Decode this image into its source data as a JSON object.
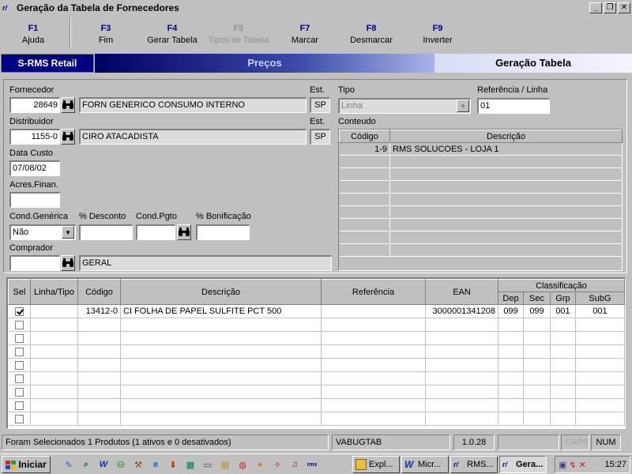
{
  "window": {
    "title": "Geração da Tabela de Fornecedores",
    "controls": {
      "minimize": "_",
      "maximize": "❐",
      "close": "✕"
    }
  },
  "fkeys": [
    {
      "key": "F1",
      "label": "Ajuda",
      "enabled": true
    },
    {
      "key": "F3",
      "label": "Fim",
      "enabled": true
    },
    {
      "key": "F4",
      "label": "Gerar Tabela",
      "enabled": true
    },
    {
      "key": "F5",
      "label": "Tipos de Tabela",
      "enabled": false
    },
    {
      "key": "F7",
      "label": "Marcar",
      "enabled": true
    },
    {
      "key": "F8",
      "label": "Desmarcar",
      "enabled": true
    },
    {
      "key": "F9",
      "label": "Inverter",
      "enabled": true
    }
  ],
  "banner": {
    "product": "S-RMS Retail",
    "module": "Preços",
    "screen": "Geração Tabela"
  },
  "form": {
    "fornecedor": {
      "label": "Fornecedor",
      "code": "28649",
      "name": "FORN GENERICO CONSUMO INTERNO",
      "est_label": "Est.",
      "est": "SP"
    },
    "distribuidor": {
      "label": "Distribuidor",
      "code": "1155-0",
      "name": "CIRO ATACADISTA",
      "est_label": "Est.",
      "est": "SP"
    },
    "data_custo": {
      "label": "Data Custo",
      "value": "07/08/02"
    },
    "acres_finan": {
      "label": "Acres.Finan.",
      "value": ""
    },
    "cond_generica": {
      "label": "Cond.Genérica",
      "value": "Não"
    },
    "desconto": {
      "label": "% Desconto",
      "value": ""
    },
    "cond_pgto": {
      "label": "Cond.Pgto",
      "value": ""
    },
    "bonificacao": {
      "label": "% Bonificação",
      "value": ""
    },
    "comprador": {
      "label": "Comprador",
      "code": "",
      "name": "GERAL"
    },
    "tipo": {
      "label": "Tipo",
      "value": "Linha"
    },
    "referencia_linha": {
      "label": "Referência / Linha",
      "value": "01"
    },
    "conteudo": {
      "label": "Conteudo",
      "columns": [
        "Código",
        "Descrição"
      ],
      "rows": [
        {
          "codigo": "1-9",
          "descricao": "RMS SOLUCOES - LOJA 1"
        }
      ]
    }
  },
  "products": {
    "columns": {
      "sel": "Sel",
      "linha_tipo": "Linha/Tipo",
      "codigo": "Código",
      "descricao": "Descrição",
      "referencia": "Referência",
      "ean": "EAN",
      "classificacao": "Classificação",
      "dep": "Dep",
      "sec": "Sec",
      "grp": "Grp",
      "subg": "SubG"
    },
    "rows": [
      {
        "sel": true,
        "linha_tipo": "",
        "codigo": "13412-0",
        "descricao": "CI FOLHA DE PAPEL SULFITE PCT 500",
        "referencia": "",
        "ean": "3000001341208",
        "dep": "099",
        "sec": "099",
        "grp": "001",
        "subg": "001"
      }
    ]
  },
  "statusbar": {
    "message": "Foram Selecionados 1 Produtos (1 ativos e 0 desativados)",
    "user": "VABUGTAB",
    "version": "1.0.28",
    "empty": "",
    "caps": "CAPS",
    "num": "NUM"
  },
  "taskbar": {
    "start": "Iniciar",
    "tasks": [
      "Expl...",
      "Micr...",
      "RMS...",
      "Gera..."
    ],
    "clock": "15:27"
  }
}
